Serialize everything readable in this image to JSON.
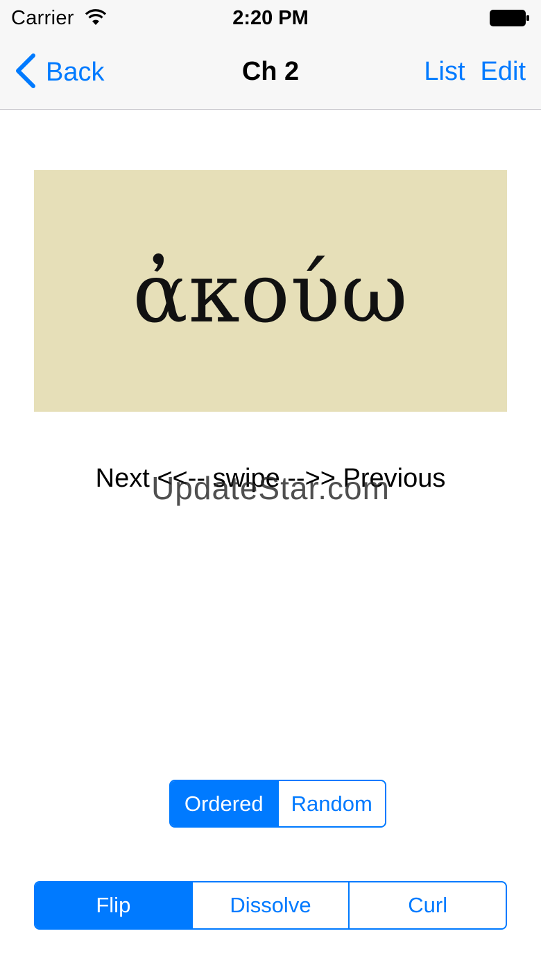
{
  "status_bar": {
    "carrier": "Carrier",
    "time": "2:20 PM"
  },
  "nav": {
    "back_label": "Back",
    "title": "Ch 2",
    "list_label": "List",
    "edit_label": "Edit"
  },
  "card": {
    "word": "ἀκούω",
    "background_color": "#e6dfb8"
  },
  "swipe_hint": "Next <<-- swipe -->> Previous",
  "watermark": "UpdateStar.com",
  "order_control": {
    "options": [
      "Ordered",
      "Random"
    ],
    "selected": "Ordered"
  },
  "transition_control": {
    "options": [
      "Flip",
      "Dissolve",
      "Curl"
    ],
    "selected": "Flip"
  },
  "colors": {
    "accent": "#007aff",
    "bar_background": "#f7f7f7"
  }
}
